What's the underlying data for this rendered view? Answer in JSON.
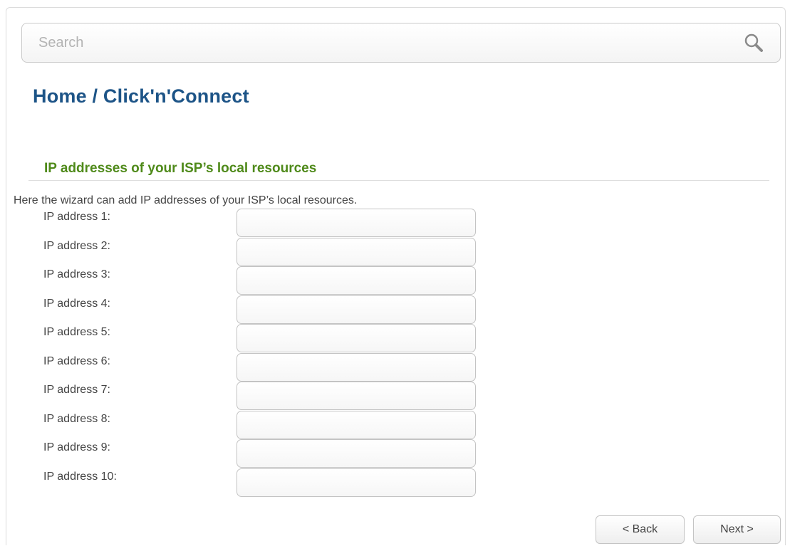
{
  "search": {
    "placeholder": "Search",
    "value": ""
  },
  "breadcrumb": {
    "title": "Home /  Click'n'Connect"
  },
  "section": {
    "title": "IP addresses of your ISP’s local resources",
    "description": "Here the wizard can add IP addresses of your ISP’s local resources."
  },
  "fields": [
    {
      "label": "IP address 1:",
      "value": ""
    },
    {
      "label": "IP address 2:",
      "value": ""
    },
    {
      "label": "IP address 3:",
      "value": ""
    },
    {
      "label": "IP address 4:",
      "value": ""
    },
    {
      "label": "IP address 5:",
      "value": ""
    },
    {
      "label": "IP address 6:",
      "value": ""
    },
    {
      "label": "IP address 7:",
      "value": ""
    },
    {
      "label": "IP address 8:",
      "value": ""
    },
    {
      "label": "IP address 9:",
      "value": ""
    },
    {
      "label": "IP address 10:",
      "value": ""
    }
  ],
  "buttons": {
    "back": "< Back",
    "next": "Next >"
  },
  "colors": {
    "title": "#1d5487",
    "section": "#4f8a1a",
    "border": "#c4c4c4"
  }
}
